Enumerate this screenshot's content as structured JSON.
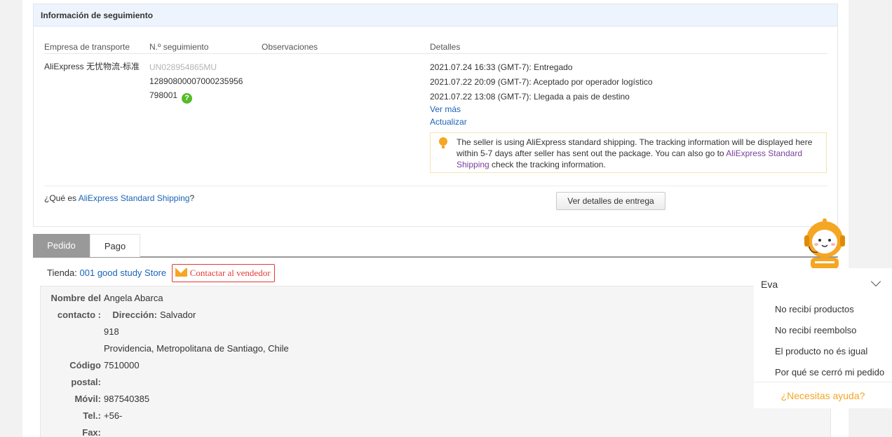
{
  "tracking": {
    "title": "Información de seguimiento",
    "columns": {
      "carrier": "Empresa de transporte",
      "number": "N.º seguimiento",
      "notes": "Observaciones",
      "details": "Detalles"
    },
    "carrier": "AliExpress 无忧物流-标准",
    "number_primary": "UN028954865MU",
    "number_secondary_line1": "1289080000700023595​6",
    "number_secondary_line2": "798001",
    "help_icon": "?",
    "events": [
      "2021.07.24 16:33 (GMT-7): Entregado",
      "2021.07.22 20:09 (GMT-7): Aceptado por operador logístico",
      "2021.07.22 13:08 (GMT-7): Llegada a pais de destino"
    ],
    "see_more": "Ver más",
    "refresh": "Actualizar",
    "notice_before": "The seller is using AliExpress standard shipping. The tracking information will be displayed here within 5-7 days after seller has sent out the package. You can also go to ",
    "notice_link": "AliExpress Standard Shipping",
    "notice_after": " check the tracking information.",
    "whatis_prefix": "¿Qué es ",
    "whatis_link": "AliExpress Standard Shipping",
    "whatis_suffix": "?",
    "delivery_button": "Ver detalles de entrega"
  },
  "tabs": [
    "Pedido",
    "Pago"
  ],
  "store": {
    "label": "Tienda:",
    "name": "001 good study Store",
    "contact_button": "Contactar al vendedor"
  },
  "address": {
    "name_label_1": "Nombre del",
    "name_label_2": "contacto :",
    "name": "Angela Abarca",
    "direction_label": "Dirección:",
    "direction_1": "Salvador",
    "direction_2": "918",
    "direction_3": "Providencia, Metropolitana de Santiago, Chile",
    "postal_label_1": "Código",
    "postal_label_2": "postal:",
    "postal": "7510000",
    "mobile_label": "Móvil:",
    "mobile": "987540385",
    "tel_label": "Tel.:",
    "tel": "+56-",
    "fax_label": "Fax:"
  },
  "chat": {
    "title": "Eva",
    "items": [
      "No recibí productos",
      "No recibí reembolso",
      "El producto no és igual",
      "Por qué se cerró mi pedido"
    ],
    "help": "¿Necesitas ayuda?"
  },
  "colors": {
    "link": "#1a64b7",
    "accent": "#f5a623",
    "danger": "#e53935",
    "success": "#55bb2a"
  }
}
